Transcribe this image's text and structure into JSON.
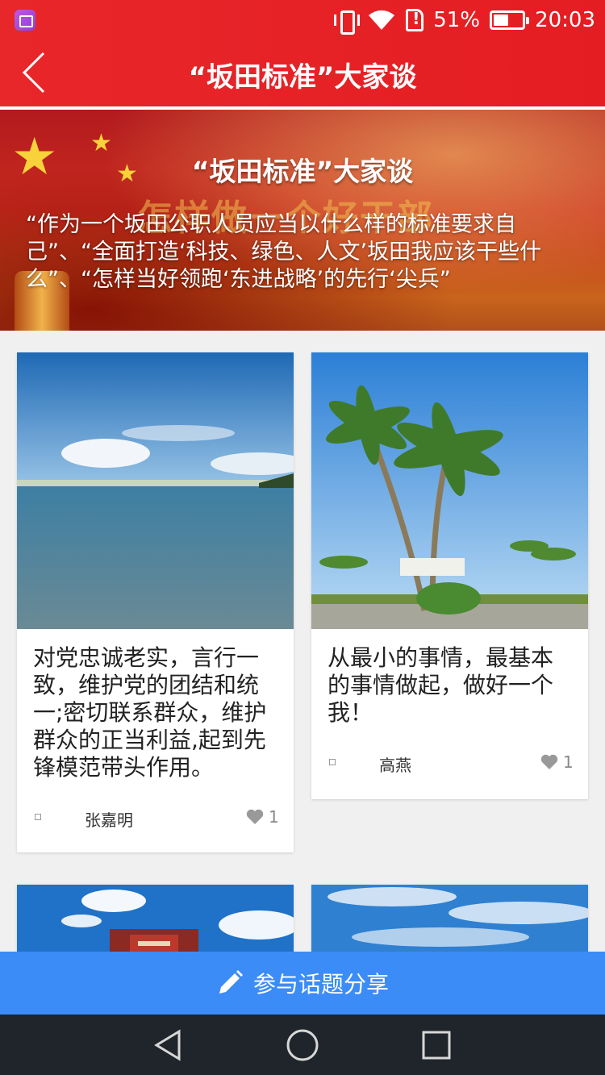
{
  "status_bar": {
    "battery_text": "51%",
    "time": "20:03",
    "icons": [
      "app-notification-icon",
      "vibrate-icon",
      "wifi-icon",
      "sim-alert-icon",
      "battery-icon"
    ]
  },
  "header": {
    "title": "“坂田标准”大家谈",
    "back_icon": "chevron-left-icon"
  },
  "banner": {
    "title": "“坂田标准”大家谈",
    "background_text": "怎样做一个好干部",
    "description": "“作为一个坂田公职人员应当以什么样的标准要求自己”、“全面打造‘科技、绿色、人文’坂田我应该干些什么”、“怎样当好领跑‘东进战略’的先行‘尖兵”"
  },
  "posts": [
    {
      "image": "sea-landscape",
      "text": "对党忠诚老实，言行一致，维护党的团结和统一;密切联系群众，维护群众的正当利益,起到先锋模范带头作用。",
      "author": "张嘉明",
      "likes": "1"
    },
    {
      "image": "palm-trees",
      "text": "从最小的事情，最基本的事情做起，做好一个我！",
      "author": "高燕",
      "likes": "1"
    },
    {
      "image": "palace-sky"
    },
    {
      "image": "cloudy-sky"
    }
  ],
  "share_button": {
    "label": "参与话题分享",
    "icon": "pencil-icon"
  },
  "nav_bar": {
    "buttons": [
      "back-triangle-icon",
      "home-circle-icon",
      "recents-square-icon"
    ]
  },
  "colors": {
    "header_red": "#e41d22",
    "share_blue": "#3b8cf7",
    "nav_dark": "#20252b"
  }
}
